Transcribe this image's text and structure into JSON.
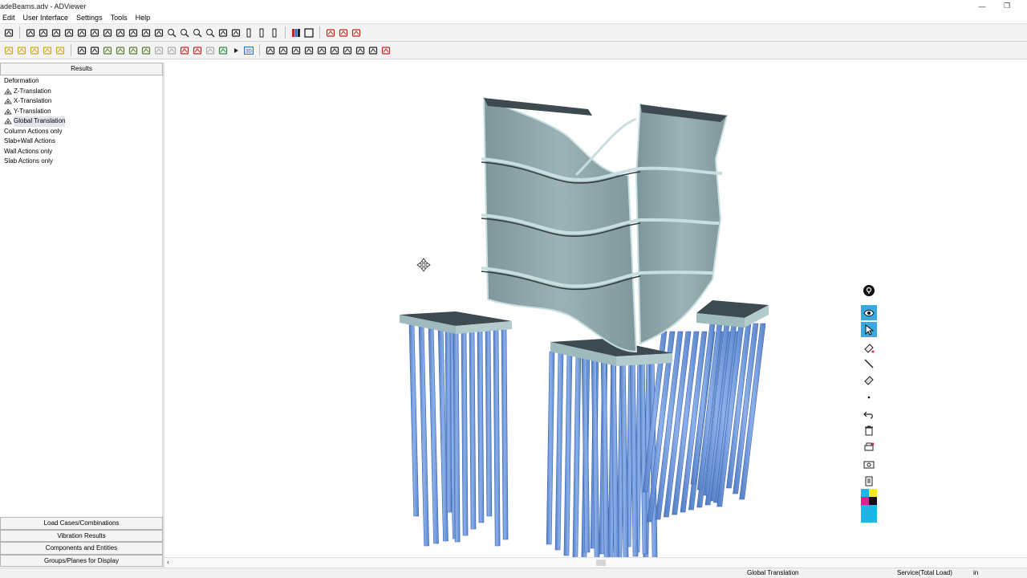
{
  "window": {
    "title": "adeBeams.adv - ADViewer"
  },
  "menu": [
    "Edit",
    "User Interface",
    "Settings",
    "Tools",
    "Help"
  ],
  "panel": {
    "header": "Results",
    "tree": [
      {
        "label": "Deformation",
        "indent": 0,
        "icon": "none"
      },
      {
        "label": "Z-Translation",
        "indent": 1,
        "icon": "result-icon"
      },
      {
        "label": "X-Translation",
        "indent": 1,
        "icon": "result-icon"
      },
      {
        "label": "Y-Translation",
        "indent": 1,
        "icon": "result-icon"
      },
      {
        "label": "Global Translation",
        "indent": 1,
        "icon": "result-icon",
        "selected": true
      },
      {
        "label": "Column Actions only",
        "indent": 0,
        "icon": "none"
      },
      {
        "label": "Slab+Wall Actions",
        "indent": 0,
        "icon": "none"
      },
      {
        "label": "Wall Actions only",
        "indent": 0,
        "icon": "none"
      },
      {
        "label": "Slab Actions only",
        "indent": 0,
        "icon": "none"
      }
    ],
    "bottom_tabs": [
      "Load Cases/Combinations",
      "Vibration Results",
      "Components and Entities",
      "Groups/Planes for Display"
    ]
  },
  "status": {
    "result": "Global Translation",
    "load": "Service(Total Load)",
    "units": "in"
  },
  "colors": {
    "structure": "#8fa7ab",
    "structure_dark": "#3d4a4f",
    "piles": "#6b93d6",
    "palette_accent": "#3aa9e0"
  },
  "toolbar_icons": {
    "row1": [
      "cursor-icon",
      "print-icon",
      "camera-icon",
      "view-icon",
      "view-icon",
      "view-icon",
      "view-icon",
      "view-icon",
      "view-icon",
      "view-icon",
      "view-icon",
      "view-icon",
      "zoom-fit-icon",
      "zoom-in-icon",
      "zoom-out-icon",
      "zoom-window-icon",
      "pan-icon",
      "rotate-icon",
      "bar-icon",
      "bar-icon",
      "bar-icon",
      "color-bars-icon",
      "frame-icon",
      "red-chart-icon",
      "red-chart-icon",
      "red-chart-icon"
    ],
    "row2": [
      "select-icon",
      "select-icon",
      "select-icon",
      "select-icon",
      "select-icon",
      "move-icon",
      "globe-icon",
      "shield-icon",
      "shield-icon",
      "shield-icon",
      "shield-icon",
      "gray-icon",
      "gray-icon",
      "load-icon",
      "load-icon",
      "gray-icon",
      "green-icon",
      "play-icon",
      "3d-icon",
      "pen-icon",
      "pen-icon",
      "pen-icon",
      "pen-icon",
      "pen-icon",
      "pen-icon",
      "pen-icon",
      "pen-icon",
      "hand-icon",
      "red-chart-icon"
    ]
  },
  "palette_icons": [
    "location-pin-icon",
    "eye-icon",
    "pointer-icon",
    "eraser-icon",
    "line-icon",
    "eraser-icon",
    "dot-icon",
    "undo-icon",
    "trash-icon",
    "print-icon",
    "camera-icon",
    "clipboard-icon",
    "color-swatch-icon"
  ]
}
